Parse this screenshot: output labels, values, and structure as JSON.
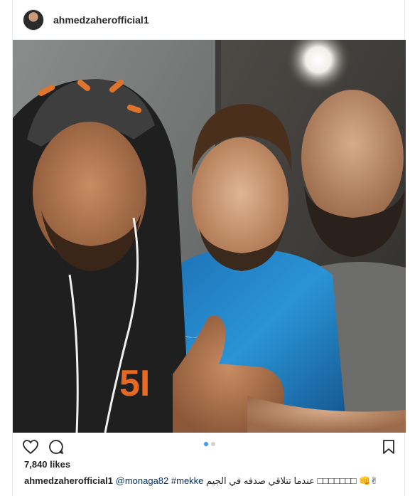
{
  "post": {
    "username": "ahmedzaherofficial1",
    "likes": "7,840 likes",
    "caption": {
      "username": "ahmedzaherofficial1",
      "mention": "@monaga82",
      "hashtag": "#mekke",
      "text": "عندما تتلاقي صدفه في الجيم",
      "boxes": "□□□□□□□",
      "emoji": "👊✌"
    }
  },
  "carousel": {
    "count": 2,
    "active_index": 0
  },
  "icons": {
    "like": "heart-icon",
    "comment": "comment-icon",
    "save": "bookmark-icon"
  },
  "colors": {
    "active_dot": "#3897f0",
    "link": "#003569"
  }
}
